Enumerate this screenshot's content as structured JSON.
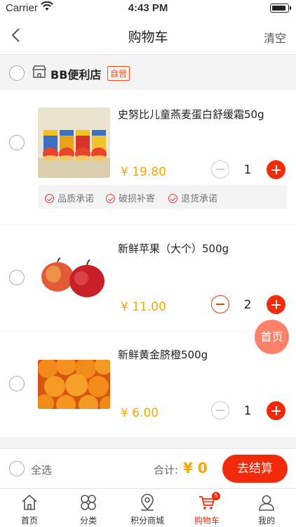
{
  "status_bar": {
    "carrier": "Carrier",
    "time": "4:43 PM"
  },
  "nav": {
    "title": "购物车",
    "clear_label": "清空"
  },
  "store": {
    "name": "BB便利店",
    "badge": "自营"
  },
  "items": [
    {
      "name": "史努比儿童燕麦蛋白舒缓霜50g",
      "price": "¥ 19.80",
      "quantity": "1"
    },
    {
      "name": "新鲜苹果（大个）500g",
      "price": "¥ 11.00",
      "quantity": "2"
    },
    {
      "name": "新鲜黄金脐橙500g",
      "price": "¥ 6.00",
      "quantity": "1"
    }
  ],
  "promises": [
    "品质承诺",
    "破损补寄",
    "退货承诺"
  ],
  "float_home_label": "首页",
  "checkout": {
    "select_all": "全选",
    "total_label": "合计:",
    "total": "¥ 0",
    "button": "去结算"
  },
  "tabs": [
    {
      "label": "首页",
      "icon": "home-icon"
    },
    {
      "label": "分类",
      "icon": "category-icon"
    },
    {
      "label": "积分商城",
      "icon": "location-pin-icon"
    },
    {
      "label": "购物车",
      "icon": "cart-icon",
      "badge": "5",
      "active": true
    },
    {
      "label": "我的",
      "icon": "user-icon"
    }
  ],
  "colors": {
    "accent": "#f02a0a",
    "price": "#f7a700"
  }
}
